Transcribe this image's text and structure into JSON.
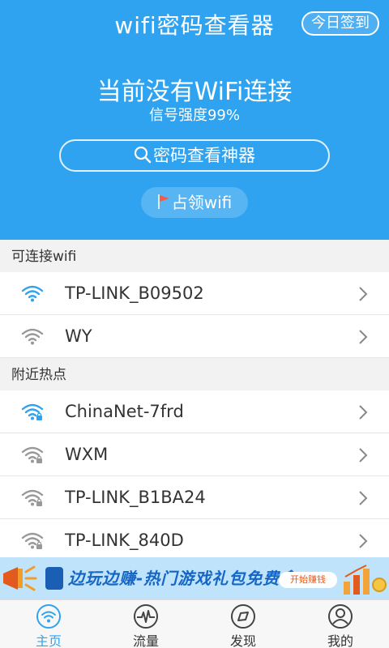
{
  "header": {
    "app_title": "wifi密码查看器",
    "checkin_label": "今日签到",
    "status_title": "当前没有WiFi连接",
    "signal_text": "信号强度99%",
    "search_label": "密码查看神器",
    "occupy_label": "占领wifi",
    "bg_color": "#2fa3f0"
  },
  "sections": {
    "connectable_title": "可连接wifi",
    "nearby_title": "附近热点"
  },
  "connectable": [
    {
      "ssid": "TP-LINK_B09502",
      "icon": "wifi-icon",
      "color": "#2fa3f0"
    },
    {
      "ssid": "WY",
      "icon": "wifi-icon",
      "color": "#999999"
    }
  ],
  "nearby": [
    {
      "ssid": "ChinaNet-7frd",
      "icon": "wifi-locked-icon",
      "color": "#2fa3f0"
    },
    {
      "ssid": "WXM",
      "icon": "wifi-locked-icon",
      "color": "#999999"
    },
    {
      "ssid": "TP-LINK_B1BA24",
      "icon": "wifi-locked-icon",
      "color": "#999999"
    },
    {
      "ssid": "TP-LINK_840D",
      "icon": "wifi-locked-icon",
      "color": "#999999"
    }
  ],
  "banner": {
    "text": "边玩边赚-热门游戏礼包免费拿",
    "button_label": "开始赚钱"
  },
  "tabs": [
    {
      "label": "主页",
      "icon": "wifi-icon"
    },
    {
      "label": "流量",
      "icon": "pulse-icon"
    },
    {
      "label": "发现",
      "icon": "compass-icon"
    },
    {
      "label": "我的",
      "icon": "user-icon"
    }
  ]
}
